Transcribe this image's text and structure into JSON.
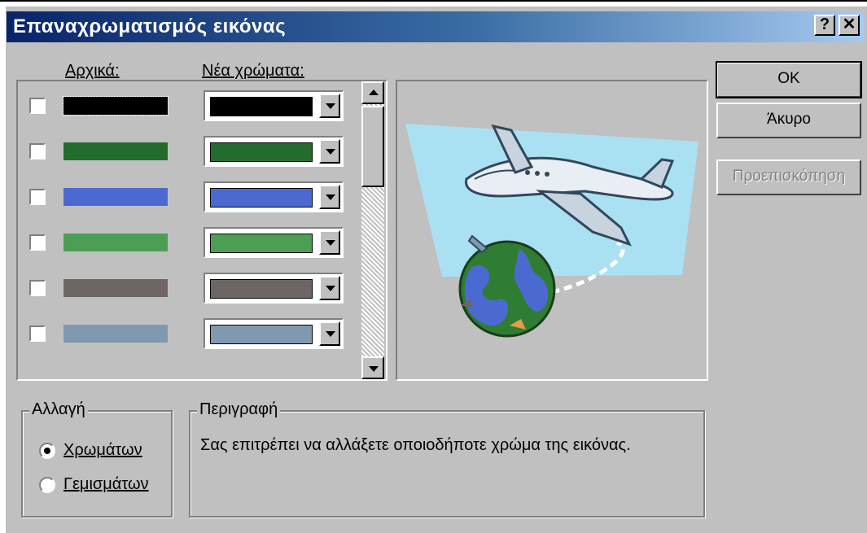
{
  "window": {
    "title": "Επαναχρωματισμός εικόνας",
    "help_label": "?",
    "close_label": "✕"
  },
  "list": {
    "original_header": "Αρχικά:",
    "new_header": "Νέα χρώματα:",
    "rows": [
      {
        "original_color": "#000000",
        "new_color": "#000000",
        "checked": false
      },
      {
        "original_color": "#246b2e",
        "new_color": "#246b2e",
        "checked": false
      },
      {
        "original_color": "#4a6ad1",
        "new_color": "#4a6ad1",
        "checked": false
      },
      {
        "original_color": "#4d9e55",
        "new_color": "#4d9e55",
        "checked": false
      },
      {
        "original_color": "#6e6664",
        "new_color": "#6e6664",
        "checked": false
      },
      {
        "original_color": "#8099b0",
        "new_color": "#8099b0",
        "checked": false
      }
    ]
  },
  "buttons": {
    "ok": "OK",
    "cancel": "Άκυρο",
    "preview": "Προεπισκόπηση"
  },
  "change_group": {
    "label": "Αλλαγή",
    "options": [
      "Χρωμάτων",
      "Γεμισμάτων"
    ],
    "selected": "Χρωμάτων"
  },
  "description_group": {
    "label": "Περιγραφή",
    "text": "Σας επιτρέπει να αλλάξετε οποιοδήποτε χρώμα της εικόνας."
  },
  "preview_image": {
    "sky_color": "#a9e1f3"
  }
}
